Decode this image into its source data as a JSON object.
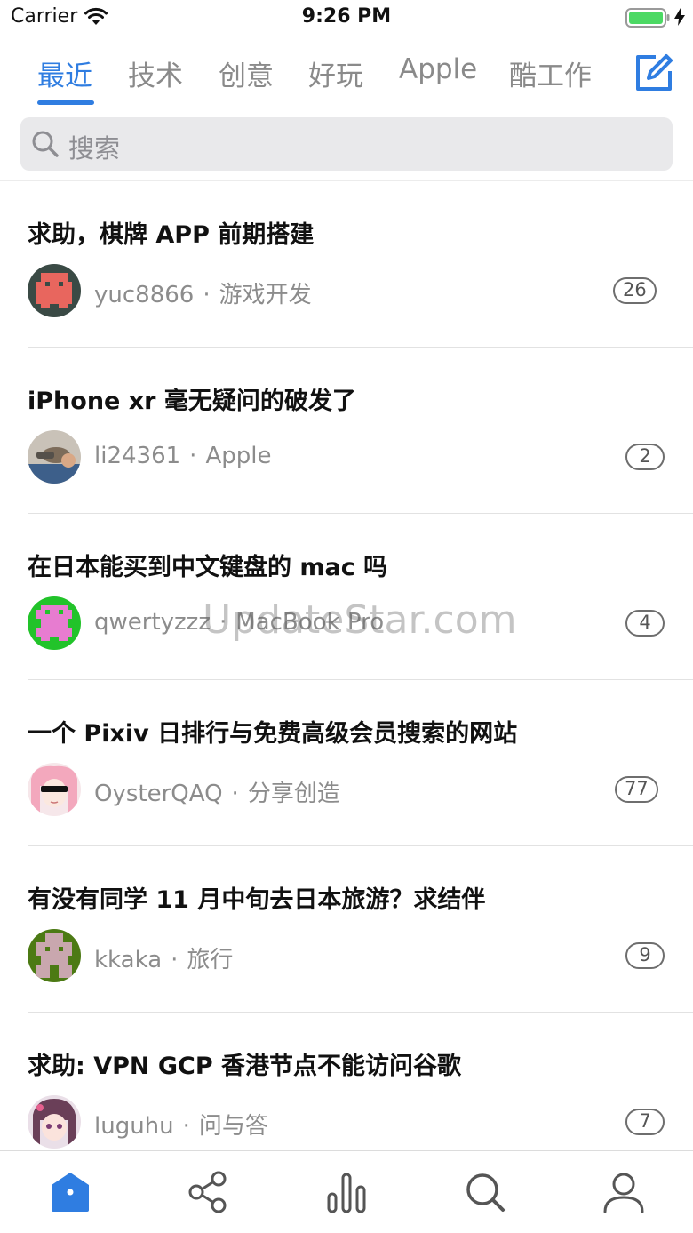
{
  "status_bar": {
    "carrier": "Carrier",
    "time": "9:26 PM",
    "battery_color": "#4cd964"
  },
  "nav": {
    "tabs": [
      {
        "label": "最近",
        "active": true
      },
      {
        "label": "技术",
        "active": false
      },
      {
        "label": "创意",
        "active": false
      },
      {
        "label": "好玩",
        "active": false
      },
      {
        "label": "Apple",
        "active": false
      },
      {
        "label": "酷工作",
        "active": false
      }
    ],
    "compose_icon": "compose-icon",
    "accent_color": "#2f7de1"
  },
  "search": {
    "placeholder": "搜索"
  },
  "topics": [
    {
      "title": "求助，棋牌 APP 前期搭建",
      "author": "yuc8866",
      "node": "游戏开发",
      "replies": "26",
      "avatar": "avatar-pixel-red"
    },
    {
      "title": "iPhone xr 毫无疑问的破发了",
      "author": "li24361",
      "node": "Apple",
      "replies": "2",
      "avatar": "avatar-photo"
    },
    {
      "title": "在日本能买到中文键盘的 mac 吗",
      "author": "qwertyzzz",
      "node": "MacBook Pro",
      "replies": "4",
      "avatar": "avatar-pixel-green"
    },
    {
      "title": "一个 Pixiv 日排行与免费高级会员搜索的网站",
      "author": "OysterQAQ",
      "node": "分享创造",
      "replies": "77",
      "avatar": "avatar-anime-sunglasses"
    },
    {
      "title": "有没有同学 11 月中旬去日本旅游？求结伴",
      "author": "kkaka",
      "node": "旅行",
      "replies": "9",
      "avatar": "avatar-pixel-olive"
    },
    {
      "title": "求助: VPN GCP 香港节点不能访问谷歌",
      "author": "luguhu",
      "node": "问与答",
      "replies": "7",
      "avatar": "avatar-anime-girl"
    }
  ],
  "meta_separator": "·",
  "watermark": "UpdateStar.com",
  "tab_bar": {
    "items": [
      "home-icon",
      "nodes-icon",
      "hot-chart-icon",
      "search-icon",
      "profile-icon"
    ],
    "active_index": 0
  }
}
